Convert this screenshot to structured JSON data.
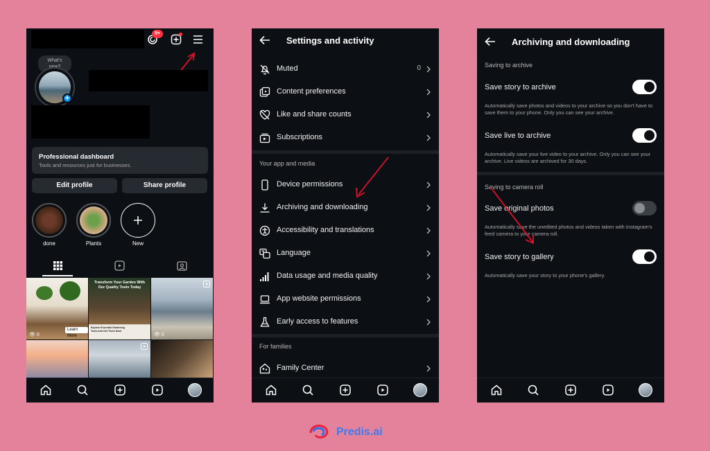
{
  "colors": {
    "page_bg": "#e4829b",
    "screen_bg": "#0c0f14",
    "accent_blue": "#0095f6",
    "annotation_red": "#e0112b",
    "badge_red": "#ff3040"
  },
  "profile": {
    "notification_badge": "9+",
    "note_bubble": [
      "What's",
      "new?"
    ],
    "dashboard_title": "Professional dashboard",
    "dashboard_subtitle": "Tools and resources just for businesses.",
    "edit_profile": "Edit profile",
    "share_profile": "Share profile",
    "highlights": [
      {
        "label": "done"
      },
      {
        "label": "Plants"
      },
      {
        "label": "New"
      }
    ],
    "grid_tiles": [
      {
        "views": "0",
        "cta": "Learn More"
      },
      {
        "headline": "Transform Your Garden With Our Quality Tools Today",
        "subline": "Explore Essential Gardening Tools And Get Them Now!"
      },
      {
        "views": "0"
      }
    ],
    "icons": [
      "threads-icon",
      "add-post-icon",
      "hamburger-menu-icon",
      "grid-icon",
      "reels-icon",
      "tagged-icon"
    ]
  },
  "settings": {
    "title": "Settings and activity",
    "rows_top": [
      {
        "label": "Muted",
        "value": "0",
        "icon": "muted-bell-icon"
      },
      {
        "label": "Content preferences",
        "icon": "content-preferences-icon"
      },
      {
        "label": "Like and share counts",
        "icon": "heart-slash-icon"
      },
      {
        "label": "Subscriptions",
        "icon": "subscriptions-icon"
      }
    ],
    "section_app_media": "Your app and media",
    "rows_app": [
      {
        "label": "Device permissions",
        "icon": "phone-icon"
      },
      {
        "label": "Archiving and downloading",
        "icon": "download-icon"
      },
      {
        "label": "Accessibility and translations",
        "icon": "accessibility-icon"
      },
      {
        "label": "Language",
        "icon": "language-icon"
      },
      {
        "label": "Data usage and media quality",
        "icon": "signal-bars-icon"
      },
      {
        "label": "App website permissions",
        "icon": "laptop-icon"
      },
      {
        "label": "Early access to features",
        "icon": "flask-icon"
      }
    ],
    "section_families": "For families",
    "rows_family": [
      {
        "label": "Family Center",
        "icon": "family-icon"
      }
    ]
  },
  "archiving": {
    "title": "Archiving and downloading",
    "section_archive": "Saving to archive",
    "section_camera": "Saving to camera roll",
    "toggles": [
      {
        "label": "Save story to archive",
        "state": "on",
        "desc": "Automatically save photos and videos to your archive so you don't have to save them to your phone. Only you can see your archive."
      },
      {
        "label": "Save live to archive",
        "state": "on",
        "desc": "Automatically save your live video to your archive. Only you can see your archive. Live videos are archived for 30 days."
      },
      {
        "label": "Save original photos",
        "state": "off",
        "desc": "Automatically save the unedited photos and videos taken with Instagram's feed camera to your camera roll."
      },
      {
        "label": "Save story to gallery",
        "state": "on",
        "desc": "Automatically save your story to your phone's gallery."
      }
    ]
  },
  "brand": {
    "name": "Predis.ai"
  }
}
